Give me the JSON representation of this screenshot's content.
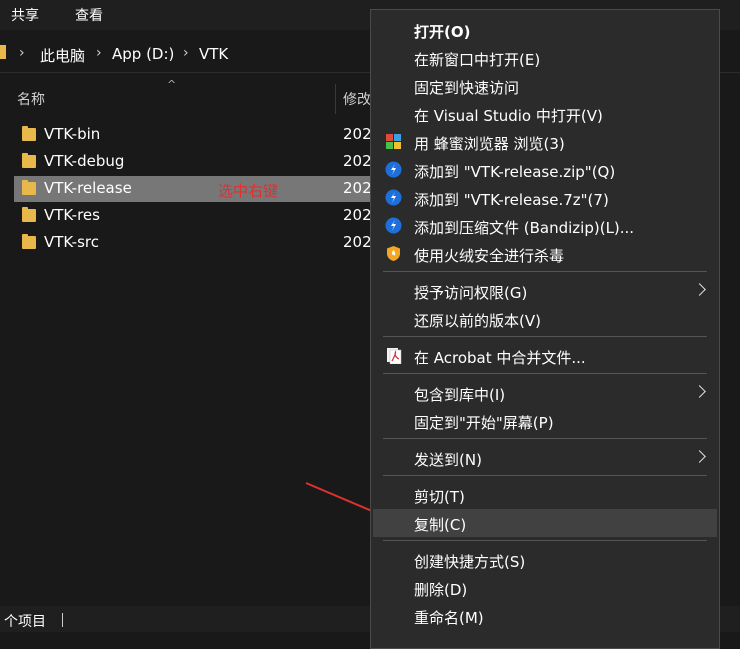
{
  "ribbon": {
    "share": "共享",
    "view": "查看"
  },
  "address": {
    "crumbs": [
      "此电脑",
      "App (D:)",
      "VTK"
    ],
    "separator": "›"
  },
  "columns": {
    "name": "名称",
    "modified": "修改",
    "sort_indicator": "^"
  },
  "files": [
    {
      "name": "VTK-bin",
      "date": "202"
    },
    {
      "name": "VTK-debug",
      "date": "202"
    },
    {
      "name": "VTK-release",
      "date": "202",
      "selected": true
    },
    {
      "name": "VTK-res",
      "date": "202"
    },
    {
      "name": "VTK-src",
      "date": "202"
    }
  ],
  "annotation": "选中右键",
  "status": {
    "count": "个项目"
  },
  "context_menu": {
    "open": "打开(O)",
    "open_new_window": "在新窗口中打开(E)",
    "pin_quick_access": "固定到快速访问",
    "open_visual_studio": "在 Visual Studio 中打开(V)",
    "browse_honey": "用 蜂蜜浏览器 浏览(3)",
    "add_zip": "添加到 \"VTK-release.zip\"(Q)",
    "add_7z": "添加到 \"VTK-release.7z\"(7)",
    "add_archive": "添加到压缩文件 (Bandizip)(L)...",
    "scan_virus": "使用火绒安全进行杀毒",
    "grant_access": "授予访问权限(G)",
    "restore_versions": "还原以前的版本(V)",
    "acrobat_merge": "在 Acrobat 中合并文件...",
    "include_library": "包含到库中(I)",
    "pin_start": "固定到\"开始\"屏幕(P)",
    "send_to": "发送到(N)",
    "cut": "剪切(T)",
    "copy": "复制(C)",
    "create_shortcut": "创建快捷方式(S)",
    "delete": "删除(D)",
    "rename": "重命名(M)"
  },
  "colors": {
    "selection": "#777777",
    "menu_bg": "#2b2b2b",
    "hover": "#414141",
    "annotation": "#e03030",
    "folder": "#e8b84a",
    "bandizip": "#1e6fd9",
    "huorong": "#f5a623"
  }
}
